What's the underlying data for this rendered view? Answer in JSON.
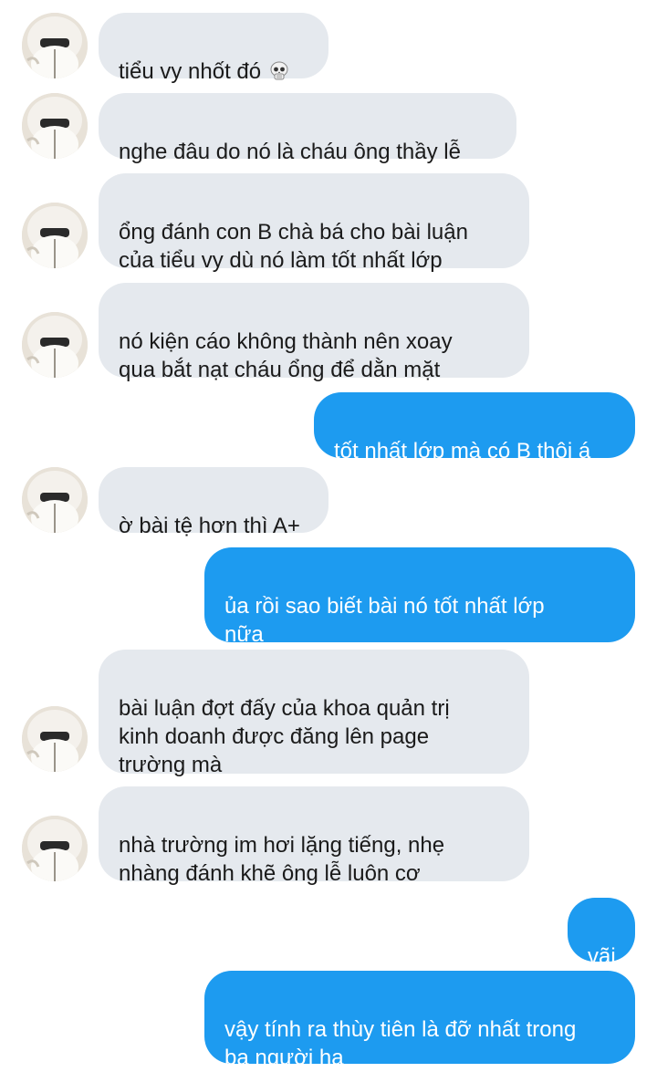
{
  "messages": [
    {
      "side": "in",
      "text": "tiểu vy nhốt đó",
      "emoji": "skull-icon"
    },
    {
      "side": "in",
      "text": "nghe đâu do nó là cháu ông thầy lễ"
    },
    {
      "side": "in",
      "text": "ổng đánh con B chà bá cho bài luận\ncủa tiểu vy dù nó làm tốt nhất lớp"
    },
    {
      "side": "in",
      "text": "nó kiện cáo không thành nên xoay\nqua bắt nạt cháu ổng để dằn mặt"
    },
    {
      "side": "out",
      "text": "tốt nhất lớp mà có B thôi á"
    },
    {
      "side": "in",
      "text": "ờ bài tệ hơn thì A+"
    },
    {
      "side": "out",
      "text": "ủa rồi sao biết bài nó tốt nhất lớp\nnữa"
    },
    {
      "side": "in",
      "text": "bài luận đợt đấy của khoa quản trị\nkinh doanh được đăng lên page\ntrường mà"
    },
    {
      "side": "in",
      "text": "nhà trường im hơi lặng tiếng, nhẹ\nnhàng đánh khẽ ông lễ luôn cơ"
    },
    {
      "side": "out",
      "text": "vãi"
    },
    {
      "side": "out",
      "text": "vậy tính ra thùy tiên là đỡ nhất trong\nba người ha"
    }
  ],
  "colors": {
    "incoming_bubble": "#e5e9ee",
    "outgoing_bubble": "#1d9bf0",
    "incoming_text": "#1a1a1a",
    "outgoing_text": "#ffffff"
  }
}
